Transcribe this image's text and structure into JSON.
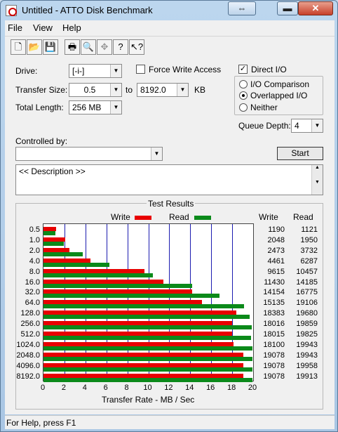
{
  "window": {
    "title": "Untitled - ATTO Disk Benchmark",
    "max_glyph": "⇔",
    "min_glyph": "▬",
    "close_glyph": "✕"
  },
  "menu": {
    "file": "File",
    "view": "View",
    "help": "Help"
  },
  "toolbar": [
    "new-icon",
    "open-icon",
    "save-icon",
    "print-icon",
    "print-preview-icon",
    "move-icon",
    "help-icon",
    "context-help-icon"
  ],
  "form": {
    "drive_label": "Drive:",
    "drive_value": "[-i-]",
    "force_write_label": "Force Write Access",
    "direct_io_label": "Direct I/O",
    "direct_io_checked": "✓",
    "transfer_label": "Transfer Size:",
    "transfer_from": "0.5",
    "to_label": "to",
    "transfer_to": "8192.0",
    "kb_label": "KB",
    "total_length_label": "Total Length:",
    "total_length_value": "256 MB",
    "io_comparison_label": "I/O Comparison",
    "overlapped_label": "Overlapped I/O",
    "neither_label": "Neither",
    "queue_depth_label": "Queue Depth:",
    "queue_depth_value": "4",
    "controlled_by_label": "Controlled by:",
    "controlled_by_value": "",
    "start_label": "Start",
    "description": "<< Description >>"
  },
  "results": {
    "title": "Test Results",
    "write_header": "Write",
    "read_header": "Read",
    "write_legend": "Write",
    "read_legend": "Read"
  },
  "chart_data": {
    "type": "bar",
    "orientation": "horizontal",
    "title": "Test Results",
    "xlabel": "Transfer Rate - MB / Sec",
    "xlim": [
      0,
      20
    ],
    "xticks": [
      "0",
      "2",
      "4",
      "6",
      "8",
      "10",
      "12",
      "14",
      "16",
      "18",
      "20"
    ],
    "categories": [
      "0.5",
      "1.0",
      "2.0",
      "4.0",
      "8.0",
      "16.0",
      "32.0",
      "64.0",
      "128.0",
      "256.0",
      "512.0",
      "1024.0",
      "2048.0",
      "4096.0",
      "8192.0"
    ],
    "series": [
      {
        "name": "Write",
        "color": "#e80000",
        "values": [
          1190,
          2048,
          2473,
          4461,
          9615,
          11430,
          14154,
          15135,
          18383,
          18016,
          18015,
          18100,
          19078,
          19078,
          19078
        ]
      },
      {
        "name": "Read",
        "color": "#0b8a1a",
        "values": [
          1121,
          1950,
          3732,
          6287,
          10457,
          14185,
          16775,
          19106,
          19680,
          19859,
          19825,
          19943,
          19943,
          19958,
          19913
        ]
      }
    ],
    "grid": true,
    "legend": "top"
  },
  "status": {
    "text": "For Help, press F1"
  }
}
